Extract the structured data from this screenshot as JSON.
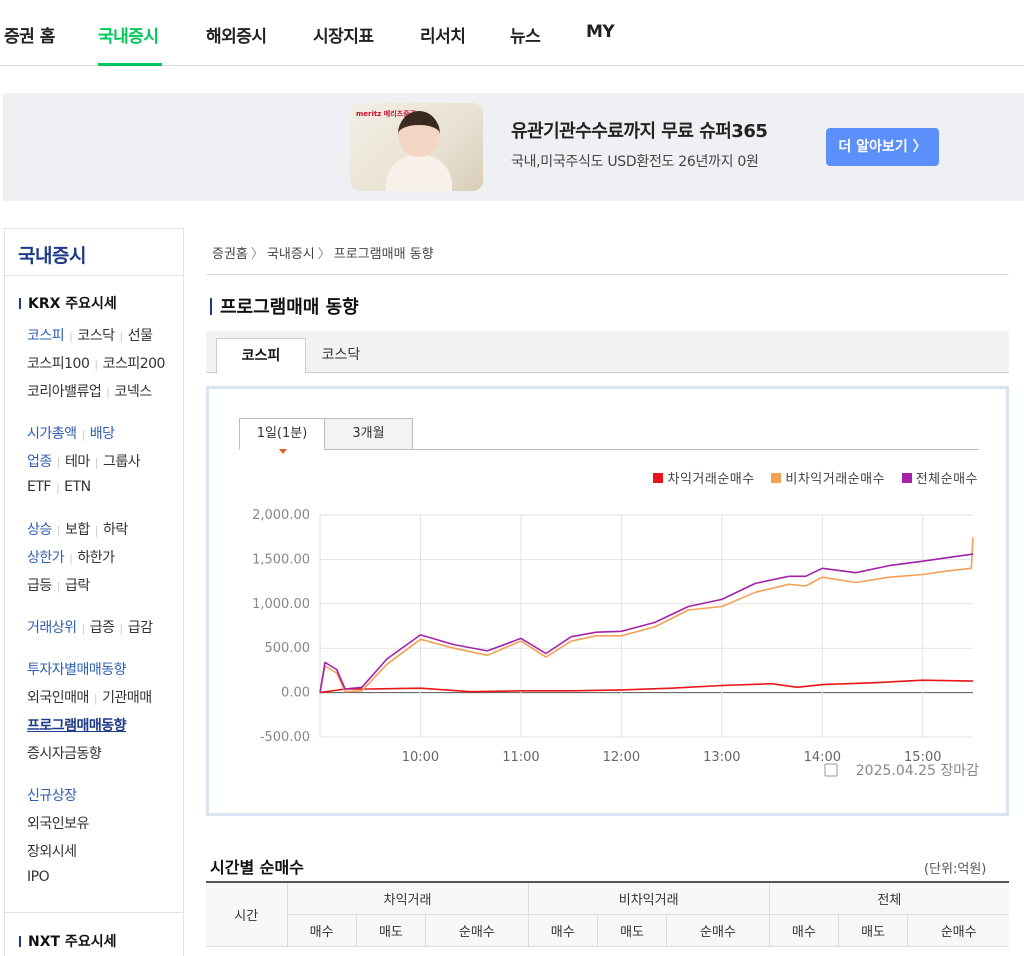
{
  "topnav": {
    "items": [
      "증권 홈",
      "국내증시",
      "해외증시",
      "시장지표",
      "리서치",
      "뉴스",
      "MY"
    ],
    "active_index": 1
  },
  "banner": {
    "brand": "meritz 메리츠증권",
    "title": "유관기관수수료까지 무료 슈퍼365",
    "subtitle": "국내,미국주식도 USD환전도 26년까지 0원",
    "button": "더 알아보기 〉"
  },
  "sidebar": {
    "title": "국내증시",
    "krx_section": "KRX 주요시세",
    "rows": [
      [
        {
          "t": "코스피",
          "c": "blue"
        },
        {
          "t": "코스닥"
        },
        {
          "t": "선물"
        }
      ],
      [
        {
          "t": "코스피100"
        },
        {
          "t": "코스피200"
        }
      ],
      [
        {
          "t": "코리아밸류업"
        },
        {
          "t": "코넥스"
        }
      ],
      [
        {
          "t": "시가총액",
          "c": "blue"
        },
        {
          "t": "배당",
          "c": "blue"
        }
      ],
      [
        {
          "t": "업종",
          "c": "blue"
        },
        {
          "t": "테마"
        },
        {
          "t": "그룹사"
        }
      ],
      [
        {
          "t": "ETF"
        },
        {
          "t": "ETN"
        }
      ],
      [
        {
          "t": "상승",
          "c": "blue"
        },
        {
          "t": "보합"
        },
        {
          "t": "하락"
        }
      ],
      [
        {
          "t": "상한가",
          "c": "blue"
        },
        {
          "t": "하한가"
        }
      ],
      [
        {
          "t": "급등"
        },
        {
          "t": "급락"
        }
      ],
      [
        {
          "t": "거래상위",
          "c": "blue"
        },
        {
          "t": "급증"
        },
        {
          "t": "급감"
        }
      ],
      [
        {
          "t": "투자자별매매동향",
          "c": "blue"
        }
      ],
      [
        {
          "t": "외국인매매"
        },
        {
          "t": "기관매매"
        }
      ],
      [
        {
          "t": "프로그램매매동향",
          "c": "cur"
        }
      ],
      [
        {
          "t": "증시자금동향"
        }
      ],
      [
        {
          "t": "신규상장",
          "c": "blue"
        }
      ],
      [
        {
          "t": "외국인보유"
        }
      ],
      [
        {
          "t": "장외시세"
        }
      ],
      [
        {
          "t": "IPO"
        }
      ]
    ],
    "nxt_section": "NXT 주요시세"
  },
  "breadcrumb": [
    "증권홈",
    "국내증시",
    "프로그램매매 동향"
  ],
  "page_title": "프로그램매매 동향",
  "market_tabs": [
    "코스피",
    "코스닥"
  ],
  "period_tabs": [
    "1일(1분)",
    "3개월"
  ],
  "chart_footer": "2025.04.25 장마감",
  "colors": {
    "accent_green": "#03c75a",
    "arbitrage": "#e8151b",
    "non_arbitrage": "#f4a056",
    "total": "#a323a8"
  },
  "chart_data": {
    "type": "line",
    "ylim": [
      -500,
      2000
    ],
    "yticks": [
      2000,
      1500,
      1000,
      500,
      0,
      -500
    ],
    "ytick_labels": [
      "2,000.00",
      "1,500.00",
      "1,000.00",
      "500.00",
      "0.00",
      "-500.00"
    ],
    "xlim": [
      "09:00",
      "15:30"
    ],
    "xticks": [
      "10:00",
      "11:00",
      "12:00",
      "13:00",
      "14:00",
      "15:00"
    ],
    "legend_position": "top-right",
    "series": [
      {
        "name": "차익거래순매수",
        "color": "#e8151b",
        "x": [
          "09:00",
          "09:15",
          "09:30",
          "10:00",
          "10:30",
          "11:00",
          "11:30",
          "12:00",
          "12:30",
          "13:00",
          "13:30",
          "13:45",
          "14:00",
          "14:30",
          "15:00",
          "15:30"
        ],
        "y": [
          0,
          40,
          40,
          50,
          10,
          20,
          20,
          30,
          50,
          80,
          100,
          60,
          90,
          110,
          140,
          130
        ]
      },
      {
        "name": "비차익거래순매수",
        "color": "#f4a056",
        "x": [
          "09:00",
          "09:03",
          "09:10",
          "09:15",
          "09:25",
          "09:40",
          "10:00",
          "10:20",
          "10:40",
          "11:00",
          "11:15",
          "11:30",
          "11:45",
          "12:00",
          "12:20",
          "12:40",
          "13:00",
          "13:20",
          "13:40",
          "13:50",
          "14:00",
          "14:20",
          "14:40",
          "15:00",
          "15:15",
          "15:29",
          "15:30"
        ],
        "y": [
          0,
          300,
          220,
          10,
          20,
          320,
          600,
          500,
          420,
          580,
          400,
          580,
          640,
          640,
          740,
          930,
          970,
          1130,
          1220,
          1200,
          1300,
          1240,
          1300,
          1330,
          1370,
          1400,
          1750
        ]
      },
      {
        "name": "전체순매수",
        "color": "#a323a8",
        "x": [
          "09:00",
          "09:03",
          "09:10",
          "09:15",
          "09:25",
          "09:40",
          "10:00",
          "10:20",
          "10:40",
          "11:00",
          "11:15",
          "11:30",
          "11:45",
          "12:00",
          "12:20",
          "12:40",
          "13:00",
          "13:20",
          "13:40",
          "13:50",
          "14:00",
          "14:20",
          "14:40",
          "15:00",
          "15:15",
          "15:30"
        ],
        "y": [
          0,
          340,
          260,
          40,
          60,
          380,
          650,
          540,
          470,
          610,
          440,
          630,
          680,
          690,
          790,
          970,
          1050,
          1230,
          1310,
          1310,
          1400,
          1350,
          1430,
          1480,
          1520,
          1560
        ]
      }
    ]
  },
  "time_table": {
    "title": "시간별 순매수",
    "unit": "(단위:억원)",
    "time_header": "시간",
    "groups": [
      "차익거래",
      "비차익거래",
      "전체"
    ],
    "sub_headers": [
      "매수",
      "매도",
      "순매수"
    ]
  }
}
